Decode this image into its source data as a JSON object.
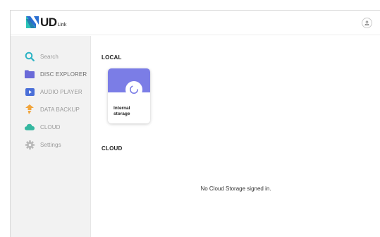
{
  "header": {
    "logo": {
      "ud_text": "UD",
      "link_text": "Link"
    },
    "account_icon": "account-icon"
  },
  "sidebar": {
    "items": [
      {
        "label": "Search",
        "icon": "search-icon",
        "icon_color": "#2bb3c4"
      },
      {
        "label": "DISC EXPLORER",
        "icon": "folder-icon",
        "icon_color": "#6a6ad8",
        "active": true
      },
      {
        "label": "AUDIO PLAYER",
        "icon": "play-icon",
        "icon_color": "#4a6fd8"
      },
      {
        "label": "DATA BACKUP",
        "icon": "backup-icon",
        "icon_color": "#f1a43a"
      },
      {
        "label": "CLOUD",
        "icon": "cloud-icon",
        "icon_color": "#35b7a0"
      },
      {
        "label": "Settings",
        "icon": "gear-icon",
        "icon_color": "#b8b8b8"
      }
    ]
  },
  "main": {
    "local_title": "LOCAL",
    "storage_card": {
      "label": "Internal\nstorage",
      "icon": "storage-icon"
    },
    "cloud_title": "CLOUD",
    "cloud_empty_message": "No Cloud Storage signed in."
  },
  "colors": {
    "accent": "#7b7de6",
    "sidebar_bg": "#f2f2f2",
    "logo_blue": "#2a6fd1",
    "logo_teal": "#2bc3b7"
  }
}
